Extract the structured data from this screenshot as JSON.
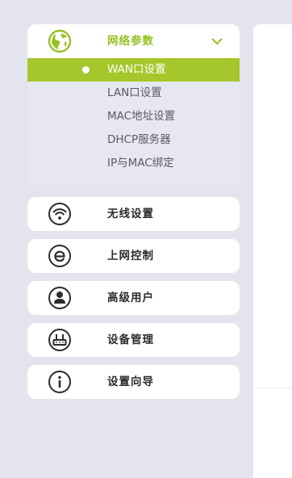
{
  "colors": {
    "accent": "#97c020",
    "selected_bg": "#a6c72b",
    "page_bg": "#e3e4ee",
    "submenu_bg": "#e6e7f2",
    "icon_dark": "#2b2b2b"
  },
  "menu": {
    "network": {
      "label": "网络参数",
      "icon": "globe-icon",
      "expanded_icon": "chevron-down-icon",
      "submenu": [
        {
          "label": "WAN口设置",
          "selected": true
        },
        {
          "label": "LAN口设置",
          "selected": false
        },
        {
          "label": "MAC地址设置",
          "selected": false
        },
        {
          "label": "DHCP服务器",
          "selected": false
        },
        {
          "label": "IP与MAC绑定",
          "selected": false
        }
      ]
    },
    "wireless": {
      "label": "无线设置",
      "icon": "wifi-icon"
    },
    "access_control": {
      "label": "上网控制",
      "icon": "internet-explorer-icon"
    },
    "advanced_users": {
      "label": "高级用户",
      "icon": "user-icon"
    },
    "device_management": {
      "label": "设备管理",
      "icon": "router-icon"
    },
    "setup_wizard": {
      "label": "设置向导",
      "icon": "info-icon"
    }
  }
}
